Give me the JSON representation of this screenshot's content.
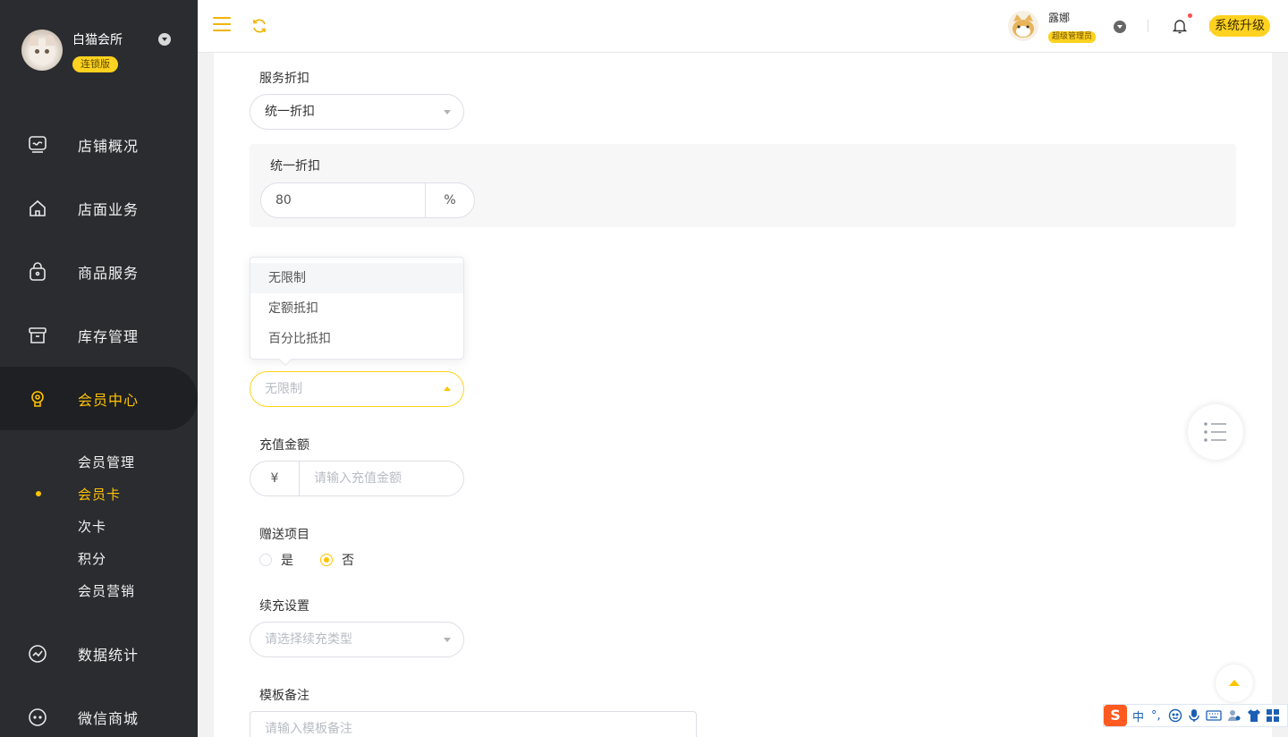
{
  "sidebar": {
    "store_name": "白猫会所",
    "store_badge": "连锁版",
    "nav": [
      {
        "label": "店铺概况",
        "icon": "monitor-icon"
      },
      {
        "label": "店面业务",
        "icon": "home-icon"
      },
      {
        "label": "商品服务",
        "icon": "bag-icon"
      },
      {
        "label": "库存管理",
        "icon": "inventory-box-icon"
      },
      {
        "label": "会员中心",
        "icon": "member-bulb-icon"
      },
      {
        "label": "数据统计",
        "icon": "chart-circle-icon"
      },
      {
        "label": "微信商城",
        "icon": "wechat-chat-icon"
      }
    ],
    "member_sub": [
      "会员管理",
      "会员卡",
      "次卡",
      "积分",
      "会员营销"
    ],
    "active_nav": "会员中心",
    "active_sub": "会员卡"
  },
  "topbar": {
    "user_name": "露娜",
    "user_role": "超级管理员",
    "upgrade_label": "系统升级"
  },
  "form": {
    "service_discount_label": "服务折扣",
    "service_discount_value": "统一折扣",
    "uniform_discount_label": "统一折扣",
    "uniform_discount_value": "80",
    "uniform_discount_unit": "%",
    "deduct_options": [
      "无限制",
      "定额抵扣",
      "百分比抵扣"
    ],
    "deduct_hover": "无限制",
    "deduct_placeholder": "无限制",
    "recharge_label": "充值金额",
    "recharge_prefix": "¥",
    "recharge_placeholder": "请输入充值金额",
    "gift_label": "赠送项目",
    "gift_yes": "是",
    "gift_no": "否",
    "gift_selected": "否",
    "renew_label": "续充设置",
    "renew_placeholder": "请选择续充类型",
    "remark_label": "模板备注",
    "remark_placeholder": "请输入模板备注"
  },
  "ime": {
    "logo": "S",
    "mode": "中",
    "punct": "°,"
  },
  "colors": {
    "accent": "#ffc300",
    "badge": "#ffd21f",
    "sidebar_bg": "#2b2c30"
  }
}
